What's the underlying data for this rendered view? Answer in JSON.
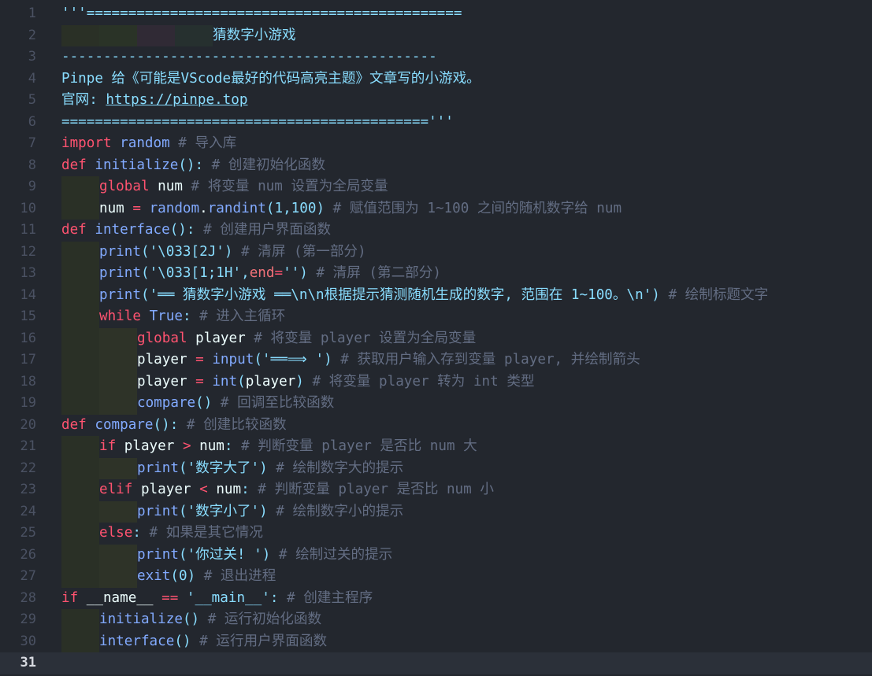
{
  "editor": {
    "language": "python",
    "current_line": 31,
    "lines": [
      {
        "n": "1",
        "indent": "",
        "tokens": [
          [
            "docstr",
            "'''============================================="
          ]
        ]
      },
      {
        "n": "2",
        "indent": "title",
        "tokens": [
          [
            "docstr",
            "猜数字小游戏"
          ]
        ]
      },
      {
        "n": "3",
        "indent": "",
        "tokens": [
          [
            "docstr",
            "---------------------------------------------"
          ]
        ]
      },
      {
        "n": "4",
        "indent": "",
        "tokens": [
          [
            "docstr",
            "Pinpe 给《可能是VScode最好的代码高亮主题》文章写的小游戏。"
          ]
        ]
      },
      {
        "n": "5",
        "indent": "",
        "tokens": [
          [
            "docstr",
            "官网: "
          ],
          [
            "link",
            "https://pinpe.top"
          ]
        ]
      },
      {
        "n": "6",
        "indent": "",
        "tokens": [
          [
            "docstr",
            "============================================'''"
          ]
        ]
      },
      {
        "n": "7",
        "indent": "",
        "tokens": [
          [
            "kw",
            "import"
          ],
          [
            "cm",
            " "
          ],
          [
            "fn",
            "random"
          ],
          [
            "cm",
            " # 导入库"
          ]
        ]
      },
      {
        "n": "8",
        "indent": "",
        "tokens": [
          [
            "kw",
            "def"
          ],
          [
            "cm",
            " "
          ],
          [
            "fn",
            "initialize"
          ],
          [
            "p",
            "():"
          ],
          [
            "cm",
            " # 创建初始化函数"
          ]
        ]
      },
      {
        "n": "9",
        "indent": "l1",
        "tokens": [
          [
            "kw",
            "global"
          ],
          [
            "cm",
            " "
          ],
          [
            "var",
            "num"
          ],
          [
            "cm",
            " # 将变量 num 设置为全局变量"
          ]
        ]
      },
      {
        "n": "10",
        "indent": "l1",
        "tokens": [
          [
            "var",
            "num"
          ],
          [
            "cm",
            " "
          ],
          [
            "op",
            "="
          ],
          [
            "cm",
            " "
          ],
          [
            "fn",
            "random"
          ],
          [
            "var",
            "."
          ],
          [
            "fn",
            "randint"
          ],
          [
            "p",
            "("
          ],
          [
            "num2",
            "1"
          ],
          [
            "p",
            ","
          ],
          [
            "num2",
            "100"
          ],
          [
            "p",
            ")"
          ],
          [
            "cm",
            " # 赋值范围为 1~100 之间的随机数字给 num"
          ]
        ]
      },
      {
        "n": "11",
        "indent": "",
        "tokens": [
          [
            "kw",
            "def"
          ],
          [
            "cm",
            " "
          ],
          [
            "fn",
            "interface"
          ],
          [
            "p",
            "():"
          ],
          [
            "cm",
            " # 创建用户界面函数"
          ]
        ]
      },
      {
        "n": "12",
        "indent": "l1",
        "tokens": [
          [
            "fn",
            "print"
          ],
          [
            "p",
            "("
          ],
          [
            "str",
            "'\\033[2J'"
          ],
          [
            "p",
            ")"
          ],
          [
            "cm",
            " # 清屏 (第一部分)"
          ]
        ]
      },
      {
        "n": "13",
        "indent": "l1",
        "tokens": [
          [
            "fn",
            "print"
          ],
          [
            "p",
            "("
          ],
          [
            "str",
            "'\\033[1;1H'"
          ],
          [
            "p",
            ","
          ],
          [
            "named",
            "end"
          ],
          [
            "op",
            "="
          ],
          [
            "str",
            "''"
          ],
          [
            "p",
            ")"
          ],
          [
            "cm",
            " # 清屏 (第二部分)"
          ]
        ]
      },
      {
        "n": "14",
        "indent": "l1",
        "tokens": [
          [
            "fn",
            "print"
          ],
          [
            "p",
            "("
          ],
          [
            "str",
            "'══ 猜数字小游戏 ══\\n\\n根据提示猜测随机生成的数字, 范围在 1~100。\\n'"
          ],
          [
            "p",
            ")"
          ],
          [
            "cm",
            " # 绘制标题文字"
          ]
        ]
      },
      {
        "n": "15",
        "indent": "l1",
        "tokens": [
          [
            "kw",
            "while"
          ],
          [
            "cm",
            " "
          ],
          [
            "bool",
            "True"
          ],
          [
            "p",
            ":"
          ],
          [
            "cm",
            " # 进入主循环"
          ]
        ]
      },
      {
        "n": "16",
        "indent": "l2",
        "tokens": [
          [
            "kw",
            "global"
          ],
          [
            "cm",
            " "
          ],
          [
            "var",
            "player"
          ],
          [
            "cm",
            " # 将变量 player 设置为全局变量"
          ]
        ]
      },
      {
        "n": "17",
        "indent": "l2",
        "tokens": [
          [
            "var",
            "player"
          ],
          [
            "cm",
            " "
          ],
          [
            "op",
            "="
          ],
          [
            "cm",
            " "
          ],
          [
            "fn",
            "input"
          ],
          [
            "p",
            "("
          ],
          [
            "str",
            "'══⟹ '"
          ],
          [
            "p",
            ")"
          ],
          [
            "cm",
            " # 获取用户输入存到变量 player, 并绘制箭头"
          ]
        ]
      },
      {
        "n": "18",
        "indent": "l2",
        "tokens": [
          [
            "var",
            "player"
          ],
          [
            "cm",
            " "
          ],
          [
            "op",
            "="
          ],
          [
            "cm",
            " "
          ],
          [
            "fn",
            "int"
          ],
          [
            "p",
            "("
          ],
          [
            "var",
            "player"
          ],
          [
            "p",
            ")"
          ],
          [
            "cm",
            " # 将变量 player 转为 int 类型"
          ]
        ]
      },
      {
        "n": "19",
        "indent": "l2",
        "tokens": [
          [
            "fn",
            "compare"
          ],
          [
            "p",
            "()"
          ],
          [
            "cm",
            " # 回调至比较函数"
          ]
        ]
      },
      {
        "n": "20",
        "indent": "",
        "tokens": [
          [
            "kw",
            "def"
          ],
          [
            "cm",
            " "
          ],
          [
            "fn",
            "compare"
          ],
          [
            "p",
            "():"
          ],
          [
            "cm",
            " # 创建比较函数"
          ]
        ]
      },
      {
        "n": "21",
        "indent": "l1",
        "tokens": [
          [
            "kw",
            "if"
          ],
          [
            "cm",
            " "
          ],
          [
            "var",
            "player"
          ],
          [
            "cm",
            " "
          ],
          [
            "op",
            ">"
          ],
          [
            "cm",
            " "
          ],
          [
            "var",
            "num"
          ],
          [
            "p",
            ":"
          ],
          [
            "cm",
            " # 判断变量 player 是否比 num 大"
          ]
        ]
      },
      {
        "n": "22",
        "indent": "l2",
        "tokens": [
          [
            "fn",
            "print"
          ],
          [
            "p",
            "("
          ],
          [
            "str",
            "'数字大了'"
          ],
          [
            "p",
            ")"
          ],
          [
            "cm",
            " # 绘制数字大的提示"
          ]
        ]
      },
      {
        "n": "23",
        "indent": "l1",
        "tokens": [
          [
            "kw",
            "elif"
          ],
          [
            "cm",
            " "
          ],
          [
            "var",
            "player"
          ],
          [
            "cm",
            " "
          ],
          [
            "op",
            "<"
          ],
          [
            "cm",
            " "
          ],
          [
            "var",
            "num"
          ],
          [
            "p",
            ":"
          ],
          [
            "cm",
            " # 判断变量 player 是否比 num 小"
          ]
        ]
      },
      {
        "n": "24",
        "indent": "l2",
        "tokens": [
          [
            "fn",
            "print"
          ],
          [
            "p",
            "("
          ],
          [
            "str",
            "'数字小了'"
          ],
          [
            "p",
            ")"
          ],
          [
            "cm",
            " # 绘制数字小的提示"
          ]
        ]
      },
      {
        "n": "25",
        "indent": "l1",
        "tokens": [
          [
            "kw",
            "else"
          ],
          [
            "p",
            ":"
          ],
          [
            "cm",
            " # 如果是其它情况"
          ]
        ]
      },
      {
        "n": "26",
        "indent": "l2",
        "tokens": [
          [
            "fn",
            "print"
          ],
          [
            "p",
            "("
          ],
          [
            "str",
            "'你过关! '"
          ],
          [
            "p",
            ")"
          ],
          [
            "cm",
            " # 绘制过关的提示"
          ]
        ]
      },
      {
        "n": "27",
        "indent": "l2",
        "tokens": [
          [
            "fn",
            "exit"
          ],
          [
            "p",
            "("
          ],
          [
            "num2",
            "0"
          ],
          [
            "p",
            ")"
          ],
          [
            "cm",
            " # 退出进程"
          ]
        ]
      },
      {
        "n": "28",
        "indent": "",
        "tokens": [
          [
            "kw",
            "if"
          ],
          [
            "cm",
            " "
          ],
          [
            "var",
            "__name__"
          ],
          [
            "cm",
            " "
          ],
          [
            "op",
            "=="
          ],
          [
            "cm",
            " "
          ],
          [
            "str",
            "'__main__'"
          ],
          [
            "p",
            ":"
          ],
          [
            "cm",
            " # 创建主程序"
          ]
        ]
      },
      {
        "n": "29",
        "indent": "l1",
        "tokens": [
          [
            "fn",
            "initialize"
          ],
          [
            "p",
            "()"
          ],
          [
            "cm",
            " # 运行初始化函数"
          ]
        ]
      },
      {
        "n": "30",
        "indent": "l1",
        "tokens": [
          [
            "fn",
            "interface"
          ],
          [
            "p",
            "()"
          ],
          [
            "cm",
            " # 运行用户界面函数"
          ]
        ]
      },
      {
        "n": "31",
        "indent": "",
        "tokens": []
      }
    ]
  }
}
